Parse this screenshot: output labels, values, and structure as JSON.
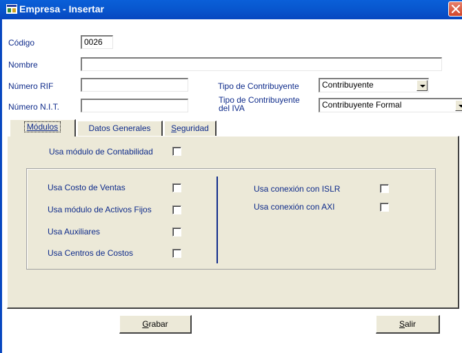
{
  "window": {
    "title": "Empresa - Insertar",
    "title_icon": "app-window-icon",
    "close_icon": "close-icon"
  },
  "form": {
    "codigo_label": "Código",
    "codigo_value": "0026",
    "nombre_label": "Nombre",
    "nombre_value": "",
    "rif_label": "Número RIF",
    "rif_value": "",
    "nit_label": "Número N.I.T.",
    "nit_value": "",
    "tipo_contribuyente_label": "Tipo de Contribuyente",
    "tipo_contribuyente_value": "Contribuyente",
    "tipo_iva_label_line1": "Tipo de Contribuyente",
    "tipo_iva_label_line2": "del IVA",
    "tipo_iva_value": "Contribuyente Formal"
  },
  "tabs": {
    "modulos": "Módulos",
    "datos_generales": "Datos Generales",
    "seguridad_first": "S",
    "seguridad_rest": "eguridad"
  },
  "modulos": {
    "contabilidad": "Usa módulo de Contabilidad",
    "costo_ventas": "Usa Costo de Ventas",
    "activos_fijos": "Usa módulo de Activos Fijos",
    "auxiliares": "Usa Auxiliares",
    "centros_costos": "Usa Centros de Costos",
    "islr": "Usa conexión con ISLR",
    "axi": "Usa conexión con AXI"
  },
  "buttons": {
    "grabar_first": "G",
    "grabar_rest": "rabar",
    "salir_first": "S",
    "salir_rest": "alir"
  }
}
